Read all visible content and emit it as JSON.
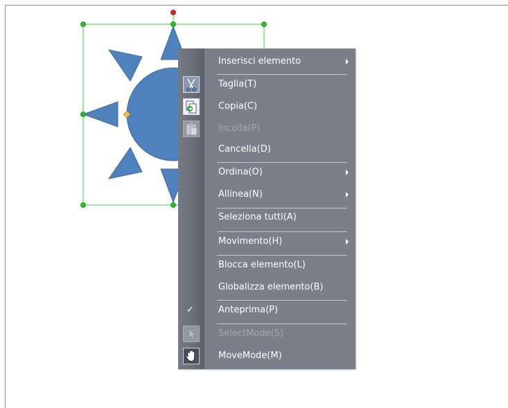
{
  "colors": {
    "shape_fill": "#4f81bd",
    "shape_stroke": "#3d6aa3",
    "selection": "#3ccf3c",
    "handle": "#22c322",
    "rotation_handle": "#e02020",
    "adjust_handle": "#f0c040",
    "menu_bg": "#7a7f89",
    "menu_text": "#ffffff",
    "menu_disabled_text": "#a4a8b0"
  },
  "shape": {
    "icon": "sun-shape"
  },
  "menu": {
    "items": [
      {
        "label": "Inserisci elemento",
        "submenu": true
      },
      {
        "label": "Taglia(T)",
        "icon": "scissors-icon"
      },
      {
        "label": "Copia(C)",
        "icon": "copy-icon"
      },
      {
        "label": "Incolla(P)",
        "icon": "paste-icon",
        "disabled": true
      },
      {
        "label": "Cancella(D)"
      },
      {
        "label": "Ordina(O)",
        "submenu": true
      },
      {
        "label": "Allinea(N)",
        "submenu": true
      },
      {
        "label": "Seleziona tutti(A)"
      },
      {
        "label": "Movimento(H)",
        "submenu": true
      },
      {
        "label": "Blocca elemento(L)"
      },
      {
        "label": "Globalizza elemento(B)"
      },
      {
        "label": "Anteprima(P)",
        "checked": true
      },
      {
        "label": "SelectMode(S)",
        "icon": "pointer-icon",
        "disabled": true
      },
      {
        "label": "MoveMode(M)",
        "icon": "hand-icon"
      }
    ]
  }
}
